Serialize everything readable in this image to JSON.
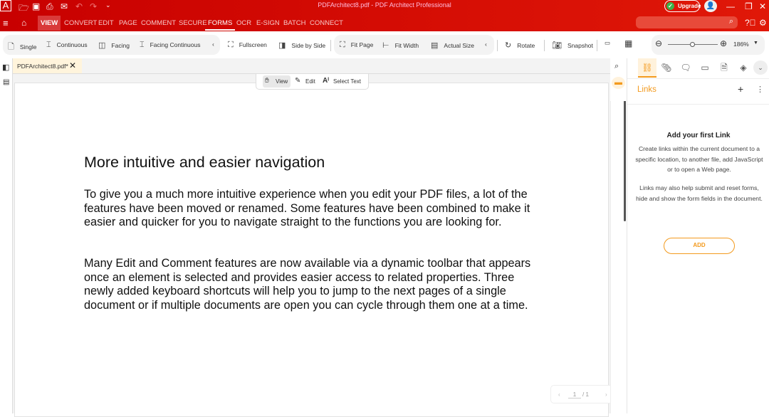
{
  "app": {
    "title": "PDFArchitect8.pdf  -  PDF Architect Professional",
    "icon": "A",
    "upgrade": "Upgrade"
  },
  "ribbon": {
    "tabs": [
      "VIEW",
      "CONVERT",
      "EDIT",
      "PAGE",
      "COMMENT",
      "SECURE",
      "FORMS",
      "OCR",
      "E-SIGN",
      "BATCH",
      "CONNECT"
    ],
    "active": "VIEW"
  },
  "toolbar": {
    "single": "Single",
    "continuous": "Continuous",
    "facing": "Facing",
    "facing_continuous": "Facing Continuous",
    "fullscreen": "Fullscreen",
    "side_by_side": "Side by Side",
    "fit_page": "Fit Page",
    "fit_width": "Fit Width",
    "actual_size": "Actual Size",
    "rotate": "Rotate",
    "snapshot": "Snapshot",
    "zoom": "186%",
    "zoom_fraction": 0.5
  },
  "document": {
    "tab": "PDFArchitect8.pdf*",
    "modes": {
      "view": "View",
      "edit": "Edit",
      "select": "Select Text"
    },
    "heading": "More intuitive and easier navigation",
    "p1": "To give you a much more intuitive experience when you edit your PDF files, a lot of the features have been moved or renamed. Some features have been combined to make it easier and quicker for you to navigate straight to the functions you are looking for.",
    "p2": "Many Edit and Comment features are now available via a dynamic toolbar that appears once an element is selected and provides easier access to related properties. Three newly added keyboard shortcuts will help you to jump to the next pages of a single document or if multiple documents are open you can cycle through them one at a time.",
    "page_current": "1",
    "page_total": "/ 1"
  },
  "panel": {
    "title": "Links",
    "heading": "Add your first Link",
    "p1": "Create links within the current document to a specific location, to another file, add JavaScript or to open a Web page.",
    "p2": "Links may also help submit and reset forms, hide and show the form fields in the document.",
    "add": "ADD"
  },
  "colors": {
    "brand": "#d00a0a",
    "accent": "#f39a1e"
  }
}
